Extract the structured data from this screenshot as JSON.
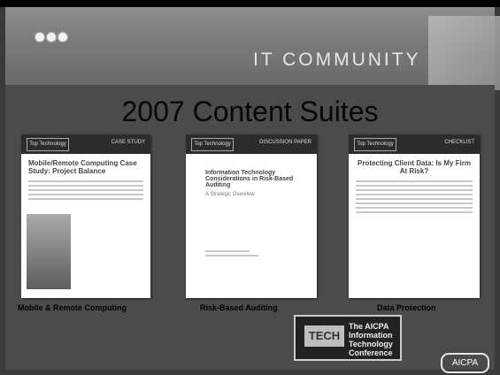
{
  "header": {
    "community": "IT COMMUNITY"
  },
  "title": "2007 Content Suites",
  "docs": [
    {
      "brand": "Top Technology",
      "type": "CASE STUDY",
      "title": "Mobile/Remote Computing Case Study: Project Balance",
      "caption": "Mobile & Remote Computing"
    },
    {
      "brand": "Top Technology",
      "type": "DISCUSSION PAPER",
      "title": "Information Technology Considerations in Risk-Based Auditing",
      "subtitle": "A Strategic Overview",
      "caption": "Risk-Based Auditing"
    },
    {
      "brand": "Top Technology",
      "type": "CHECKLIST",
      "title": "Protecting Client Data: Is My Firm At Risk?",
      "caption": "Data Protection"
    }
  ],
  "badge": {
    "logo": "TECH",
    "text": "The AICPA Information Technology Conference"
  },
  "aicpa": "AICPA"
}
